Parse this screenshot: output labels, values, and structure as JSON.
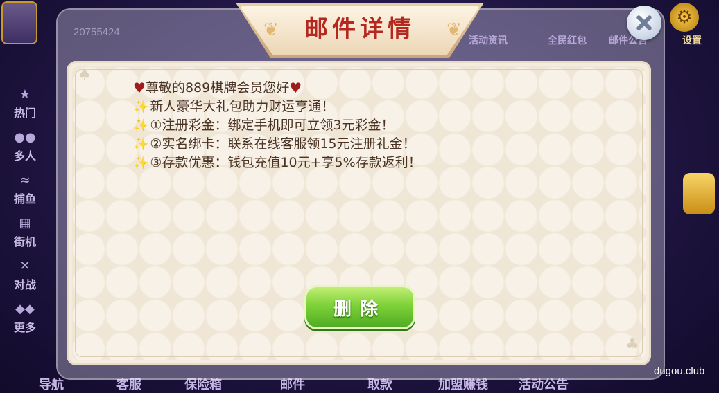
{
  "background": {
    "user_id": "20755424",
    "side_nav": [
      {
        "label": "热门",
        "icon": "new-icon"
      },
      {
        "label": "多人",
        "icon": "people-icon"
      },
      {
        "label": "捕鱼",
        "icon": "fish-icon"
      },
      {
        "label": "街机",
        "icon": "slot-icon"
      },
      {
        "label": "对战",
        "icon": "battle-icon"
      },
      {
        "label": "更多",
        "icon": "grid-icon"
      }
    ],
    "top_menu": [
      "活动资讯",
      "全民红包",
      "邮件公告"
    ],
    "settings_label": "设置",
    "bottom_nav": [
      "导航",
      "客服",
      "保险箱",
      "邮件",
      "取款",
      "加盟赚钱",
      "活动公告"
    ]
  },
  "dialog": {
    "title": "邮件详情",
    "message": {
      "greeting": "尊敬的889棋牌会员您好",
      "line1": "新人豪华大礼包助力财运亨通！",
      "line2": "①注册彩金：绑定手机即可立领3元彩金！",
      "line3": "②实名绑卡：联系在线客服领15元注册礼金！",
      "line4": "③存款优惠：钱包充值10元+享5%存款返利！"
    },
    "delete_label": "删除"
  },
  "watermark": "dugou.club",
  "colors": {
    "title_red": "#b4281f",
    "button_green": "#7fd23a",
    "panel_cream": "#f4ecdf",
    "text_brown": "#4a3323"
  }
}
